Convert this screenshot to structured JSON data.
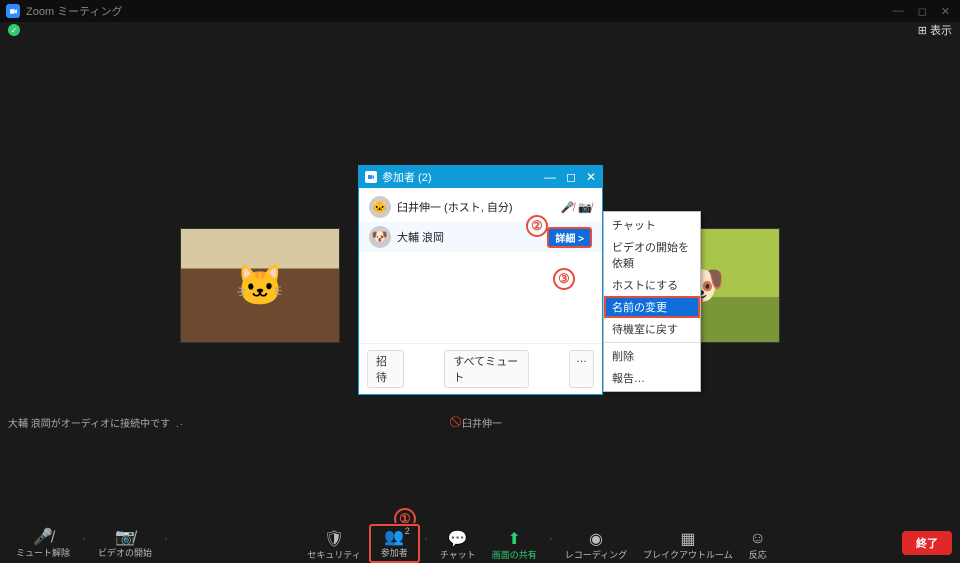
{
  "window": {
    "title": "Zoom ミーティング",
    "view_label": "表示"
  },
  "status": {
    "audio_connecting": "大輔 浪岡がオーディオに接続中です",
    "center_name": "臼井伸一"
  },
  "panel": {
    "title": "参加者 (2)",
    "participants": [
      {
        "name": "臼井伸一 (ホスト, 自分)"
      },
      {
        "name": "大輔 浪岡"
      }
    ],
    "details_button": "詳細 >",
    "footer": {
      "invite": "招待",
      "mute_all": "すべてミュート",
      "more": "…"
    }
  },
  "context_menu": {
    "items": [
      "チャット",
      "ビデオの開始を依頼",
      "ホストにする",
      "名前の変更",
      "待機室に戻す",
      "削除",
      "報告…"
    ],
    "highlighted_index": 3
  },
  "callouts": {
    "one": "①",
    "two": "②",
    "three": "③"
  },
  "toolbar": {
    "mute": "ミュート解除",
    "video": "ビデオの開始",
    "security": "セキュリティ",
    "participants": "参加者",
    "participants_count": "2",
    "chat": "チャット",
    "share": "画面の共有",
    "record": "レコーディング",
    "breakout": "ブレイクアウトルーム",
    "reactions": "反応",
    "end": "終了"
  }
}
